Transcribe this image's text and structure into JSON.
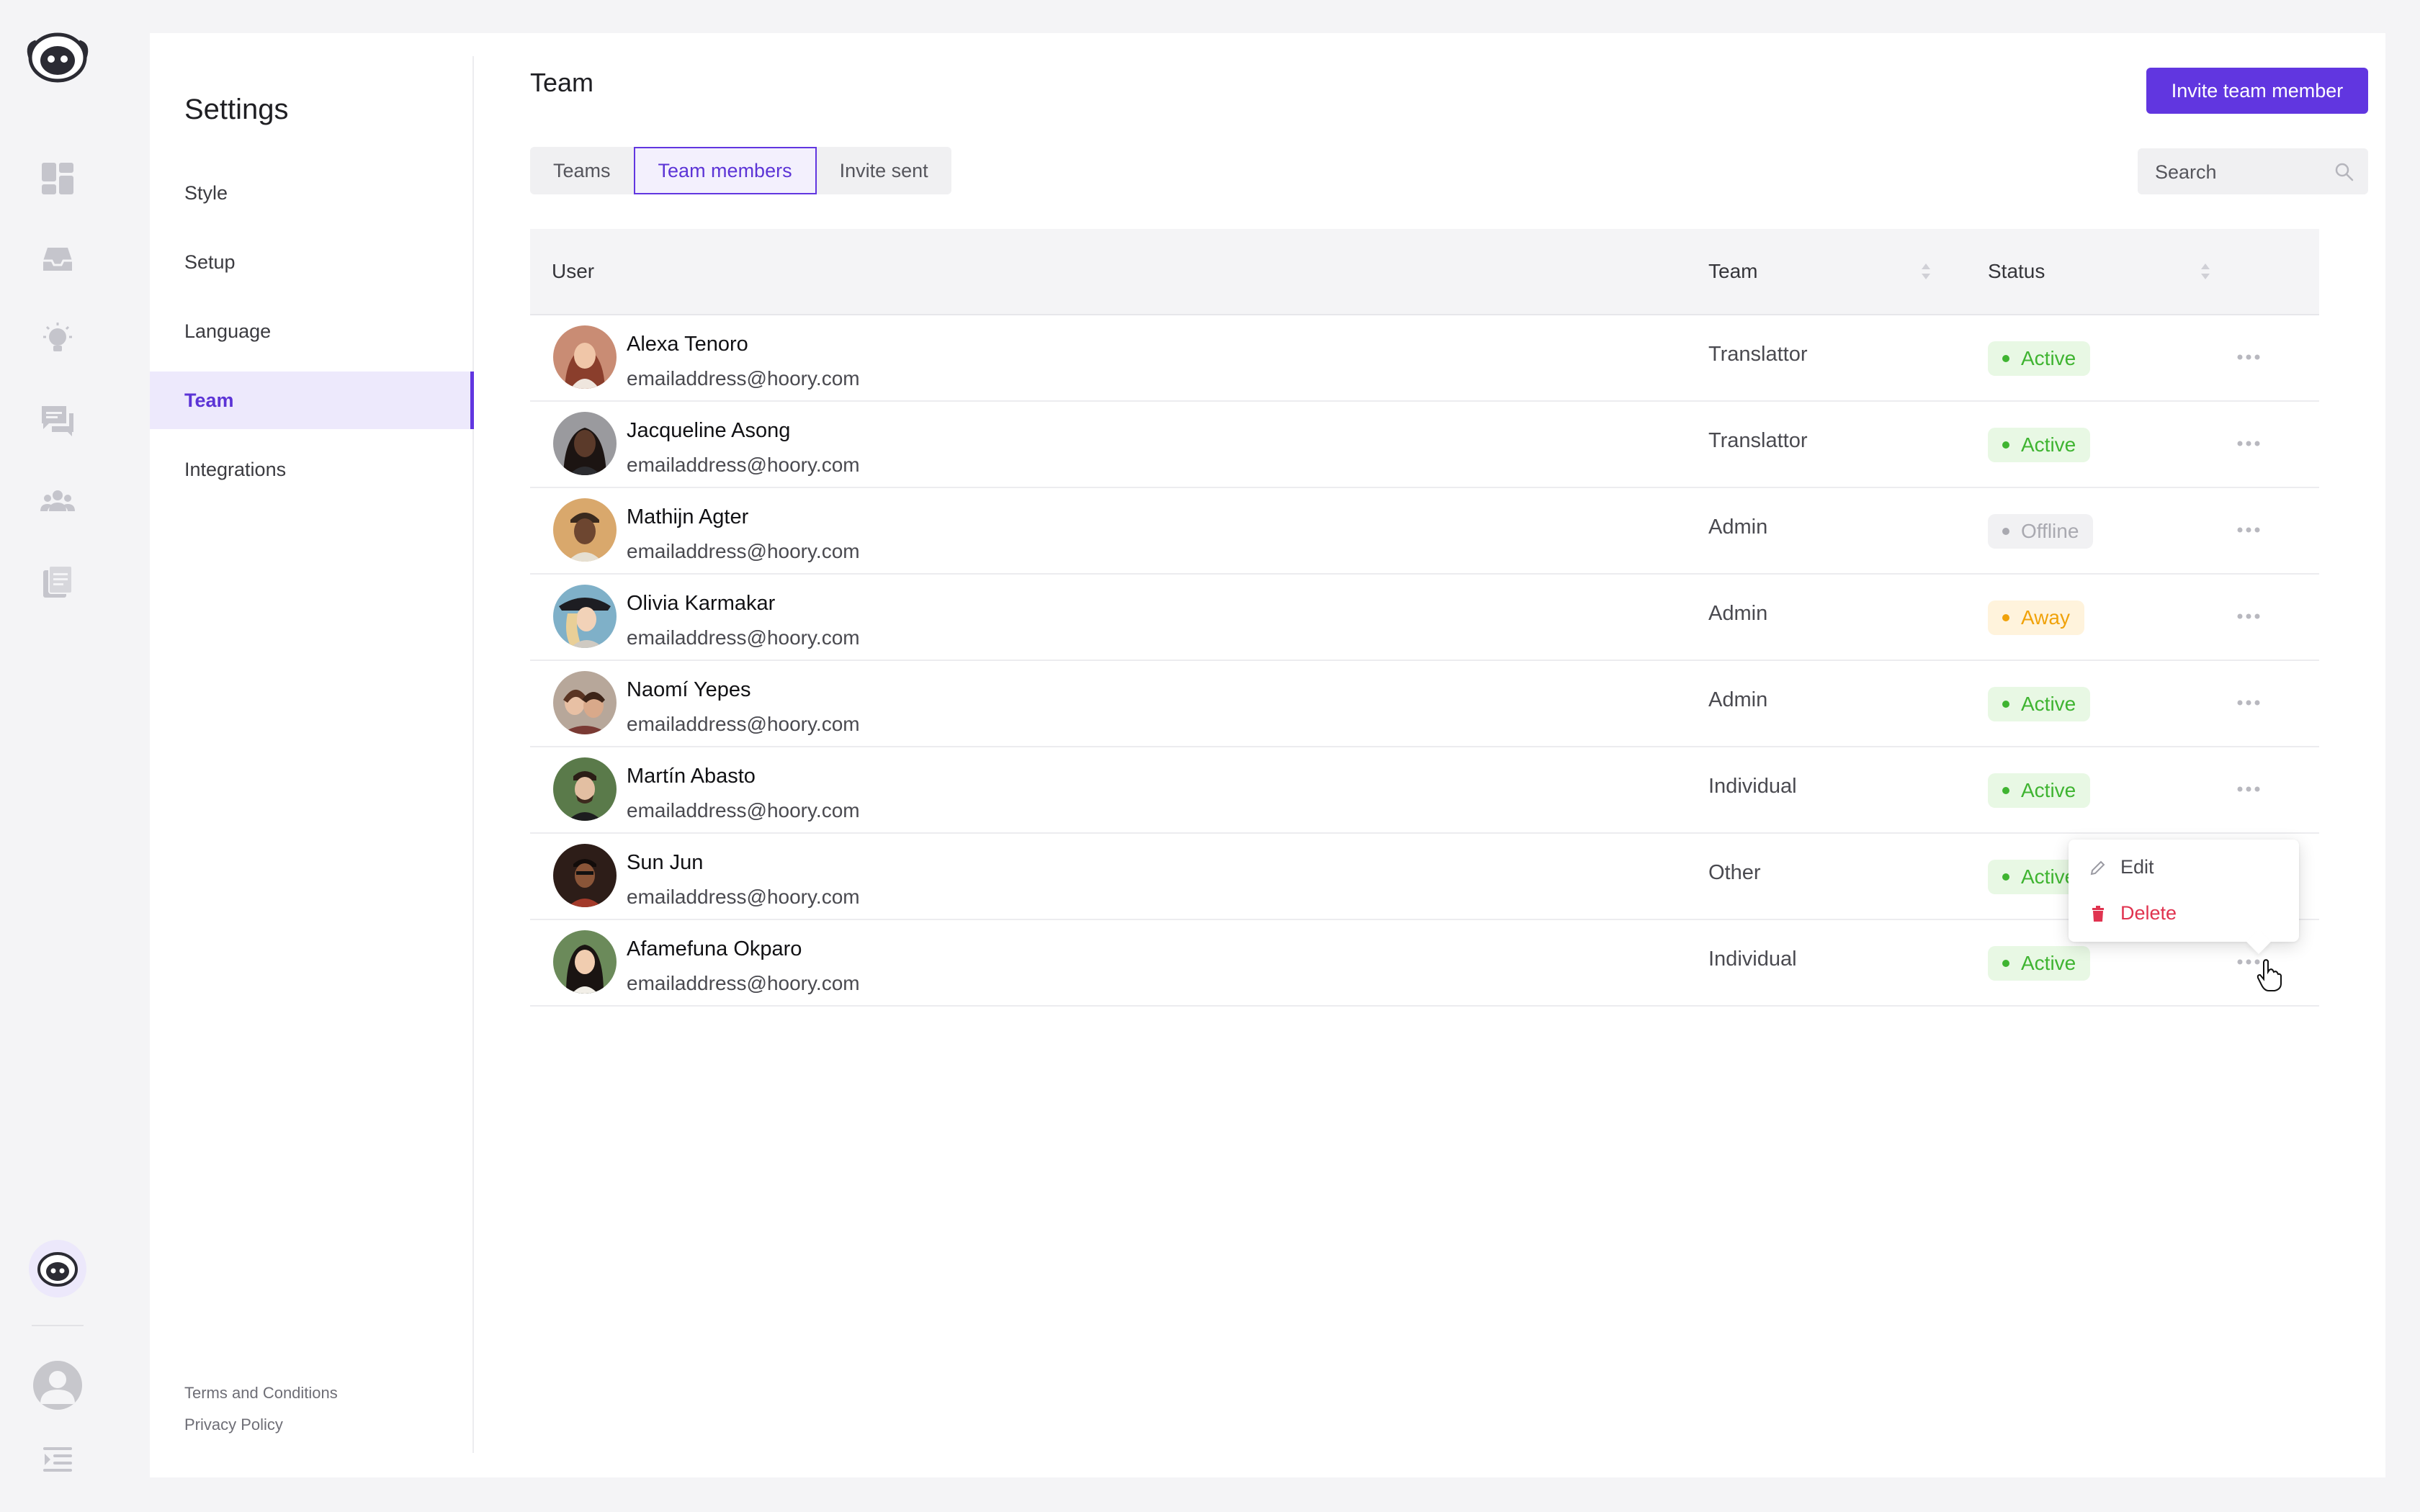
{
  "settings": {
    "title": "Settings",
    "menu": [
      {
        "label": "Style"
      },
      {
        "label": "Setup"
      },
      {
        "label": "Language"
      },
      {
        "label": "Team"
      },
      {
        "label": "Integrations"
      }
    ],
    "footer": {
      "terms": "Terms and Conditions",
      "privacy": "Privacy Policy"
    }
  },
  "rail": {
    "icons": [
      "dashboard-icon",
      "inbox-icon",
      "lightbulb-icon",
      "chat-icon",
      "contacts-icon",
      "pages-icon"
    ]
  },
  "page": {
    "title": "Team",
    "invite_label": "Invite team member",
    "tabs": [
      {
        "label": "Teams"
      },
      {
        "label": "Team members"
      },
      {
        "label": "Invite sent"
      }
    ],
    "active_tab": "Team members",
    "search_placeholder": "Search"
  },
  "table": {
    "headers": {
      "user": "User",
      "team": "Team",
      "status": "Status"
    },
    "rows": [
      {
        "name": "Alexa Tenoro",
        "email": "emailaddress@hoory.com",
        "team": "Translattor",
        "status": "Active"
      },
      {
        "name": "Jacqueline Asong",
        "email": "emailaddress@hoory.com",
        "team": "Translattor",
        "status": "Active"
      },
      {
        "name": "Mathijn Agter",
        "email": "emailaddress@hoory.com",
        "team": "Admin",
        "status": "Offline"
      },
      {
        "name": "Olivia Karmakar",
        "email": "emailaddress@hoory.com",
        "team": "Admin",
        "status": "Away"
      },
      {
        "name": "Naomí Yepes",
        "email": "emailaddress@hoory.com",
        "team": "Admin",
        "status": "Active"
      },
      {
        "name": "Martín Abasto",
        "email": "emailaddress@hoory.com",
        "team": "Individual",
        "status": "Active"
      },
      {
        "name": "Sun Jun",
        "email": "emailaddress@hoory.com",
        "team": "Other",
        "status": "Active"
      },
      {
        "name": "Afamefuna Okparo",
        "email": "emailaddress@hoory.com",
        "team": "Individual",
        "status": "Active"
      }
    ]
  },
  "dropdown": {
    "edit": "Edit",
    "delete": "Delete"
  },
  "colors": {
    "accent": "#6136e0",
    "active": "#3fb431",
    "away": "#f0a20a",
    "offline": "#a9a9b0",
    "danger": "#e0334f"
  }
}
